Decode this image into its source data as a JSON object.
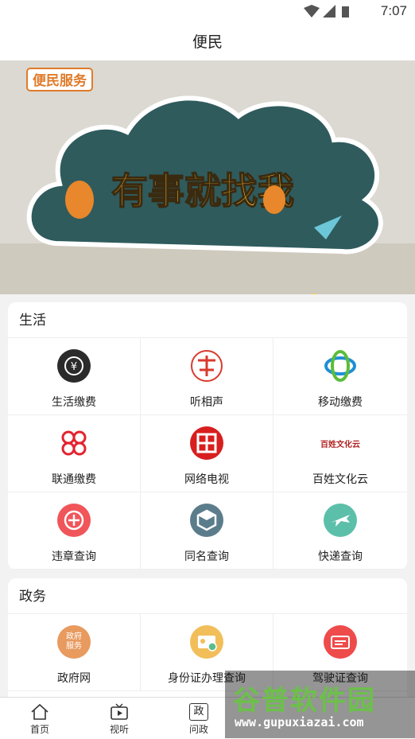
{
  "status": {
    "time": "7:07"
  },
  "header": {
    "title": "便民"
  },
  "banner": {
    "tag": "便民服务",
    "headline": "有事就找我"
  },
  "sections": [
    {
      "title": "生活",
      "items": [
        {
          "label": "生活缴费",
          "icon": "yuan-coin-icon",
          "color": "#2b2b2b"
        },
        {
          "label": "听相声",
          "icon": "crosstalk-logo-icon",
          "color": "#d83a2c"
        },
        {
          "label": "移动缴费",
          "icon": "china-mobile-icon",
          "color": "#1f8fd6"
        },
        {
          "label": "联通缴费",
          "icon": "china-unicom-icon",
          "color": "#e3232f"
        },
        {
          "label": "网络电视",
          "icon": "network-tv-icon",
          "color": "#d81e1e"
        },
        {
          "label": "百姓文化云",
          "icon": "culture-cloud-icon",
          "color": "#b22222",
          "icon_text": "百姓文化云"
        },
        {
          "label": "违章查询",
          "icon": "violation-icon",
          "color": "#f0555a"
        },
        {
          "label": "同名查询",
          "icon": "same-name-icon",
          "color": "#5b7c8b"
        },
        {
          "label": "快递查询",
          "icon": "plane-icon",
          "color": "#5cbfa9"
        }
      ]
    },
    {
      "title": "政务",
      "items": [
        {
          "label": "政府网",
          "icon": "government-icon",
          "color": "#e89a5f",
          "icon_text": "政府服务"
        },
        {
          "label": "身份证办理查询",
          "icon": "id-card-icon",
          "color": "#f2be5a"
        },
        {
          "label": "驾驶证查询",
          "icon": "driver-license-icon",
          "color": "#ee4b4b"
        }
      ]
    }
  ],
  "nav": [
    {
      "label": "首页",
      "icon": "home-icon"
    },
    {
      "label": "视听",
      "icon": "tv-icon"
    },
    {
      "label": "问政",
      "icon": "wenzheng-icon",
      "icon_text": "政"
    }
  ],
  "watermark": {
    "title": "谷普软件园",
    "url": "www.gupuxiazai.com"
  }
}
